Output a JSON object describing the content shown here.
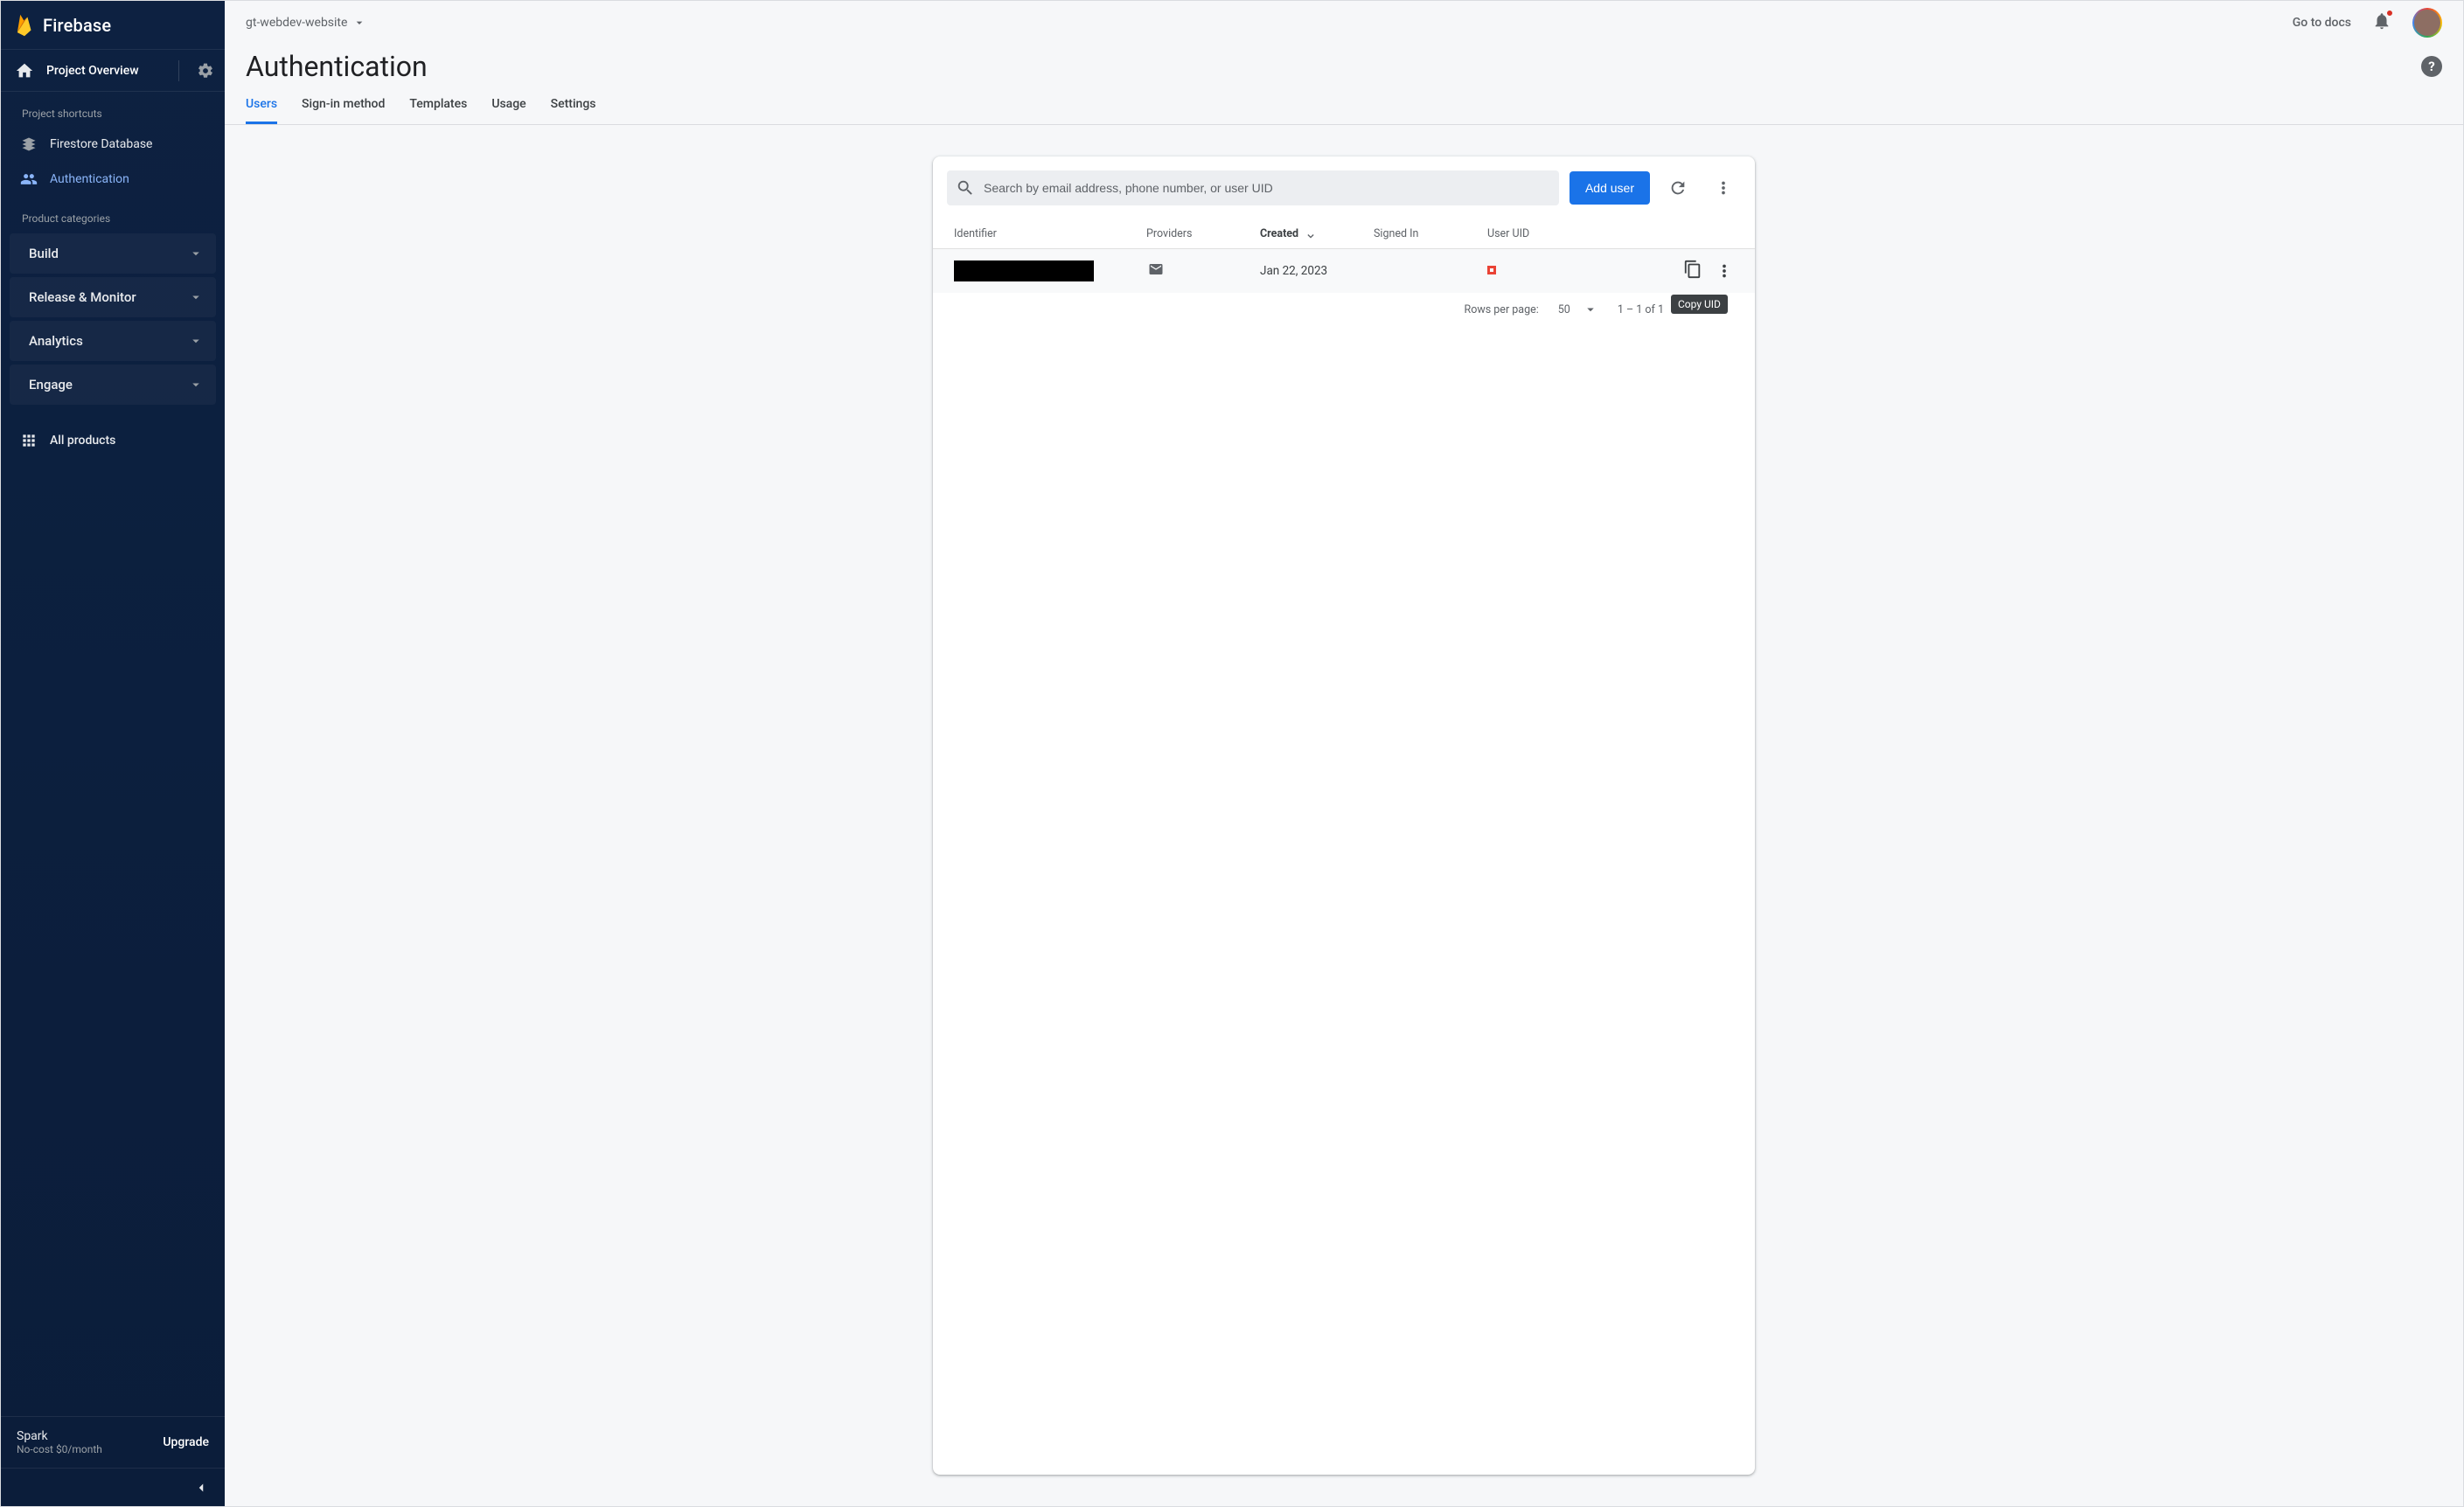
{
  "brand": "Firebase",
  "sidebar": {
    "overview_label": "Project Overview",
    "shortcuts_title": "Project shortcuts",
    "shortcuts": [
      {
        "label": "Firestore Database",
        "icon": "firestore"
      },
      {
        "label": "Authentication",
        "icon": "auth",
        "active": true
      }
    ],
    "categories_title": "Product categories",
    "categories": [
      {
        "label": "Build"
      },
      {
        "label": "Release & Monitor"
      },
      {
        "label": "Analytics"
      },
      {
        "label": "Engage"
      }
    ],
    "all_products_label": "All products",
    "plan_name": "Spark",
    "plan_sub": "No-cost $0/month",
    "upgrade_label": "Upgrade"
  },
  "topbar": {
    "project_name": "gt-webdev-website",
    "docs_label": "Go to docs"
  },
  "page": {
    "title": "Authentication",
    "tabs": [
      {
        "label": "Users",
        "active": true
      },
      {
        "label": "Sign-in method"
      },
      {
        "label": "Templates"
      },
      {
        "label": "Usage"
      },
      {
        "label": "Settings"
      }
    ]
  },
  "toolbar": {
    "search_placeholder": "Search by email address, phone number, or user UID",
    "add_user_label": "Add user"
  },
  "table": {
    "headers": {
      "identifier": "Identifier",
      "providers": "Providers",
      "created": "Created",
      "signed_in": "Signed In",
      "user_uid": "User UID"
    },
    "rows": [
      {
        "identifier": "[redacted]",
        "provider": "email",
        "created": "Jan 22, 2023",
        "signed_in": "",
        "user_uid": "[redacted]"
      }
    ],
    "copy_tooltip": "Copy UID"
  },
  "pager": {
    "rows_per_page_label": "Rows per page:",
    "rows_per_page_value": "50",
    "range": "1 – 1 of 1"
  }
}
